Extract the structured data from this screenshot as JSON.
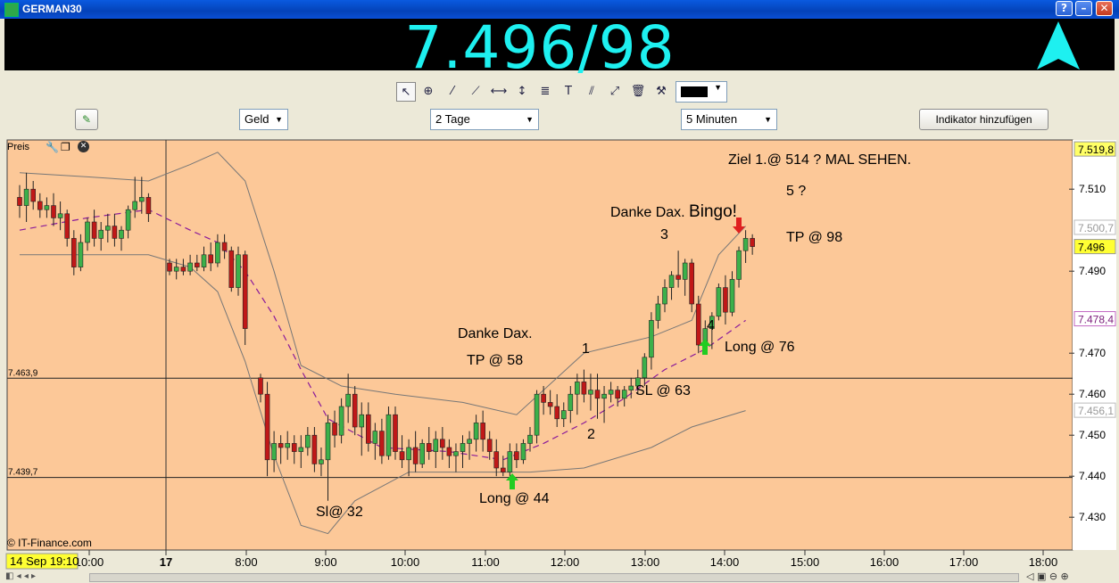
{
  "window": {
    "title": "GERMAN30"
  },
  "quote": {
    "value": "7.496/98",
    "direction": "up",
    "color": "#1ef0f0"
  },
  "toolbar": {
    "tools": [
      "pointer-icon",
      "zoom-icon",
      "line-icon",
      "extended-line-icon",
      "horizontal-line-icon",
      "vertical-line-icon",
      "fibonacci-icon",
      "text-icon",
      "parallel-lines-icon",
      "trend-channel-icon",
      "trash-icon",
      "tools-icon"
    ],
    "color_swatch": "#000000"
  },
  "controls": {
    "price_type": "Geld",
    "period": "2 Tage",
    "interval": "5 Minuten",
    "add_indicator": "Indikator hinzufügen"
  },
  "chart": {
    "panel_label": "Preis",
    "copyright": "© IT-Finance.com",
    "background": "#fcc898",
    "yticks": [
      "7.510",
      "7.490",
      "7.480",
      "7.470",
      "7.460",
      "7.450",
      "7.440",
      "7.430"
    ],
    "xticks": [
      "10:00",
      "17",
      "8:00",
      "9:00",
      "10:00",
      "11:00",
      "12:00",
      "13:00",
      "14:00",
      "15:00",
      "16:00",
      "17:00",
      "18:00"
    ],
    "date_badge": "14 Sep 19:10",
    "price_badges": {
      "high": "7.519,8",
      "upper_band": "7.500,7",
      "last": "7.496",
      "ma": "7.478,4",
      "lower_band": "7.456,1"
    },
    "hlines": [
      {
        "label": "7.463,9"
      },
      {
        "label": "7.439,7"
      }
    ],
    "annotations": {
      "ziel": "Ziel 1.@ 514 ? MAL SEHEN.",
      "five": "5 ?",
      "danke_bingo_a": "Danke Dax.",
      "danke_bingo_b": "Bingo!",
      "tp98": "TP @ 98",
      "three": "3",
      "four": "4",
      "long76": "Long @ 76",
      "danke": "Danke Dax.",
      "tp58": "TP @ 58",
      "one": "1",
      "sl63": "SL @ 63",
      "two": "2",
      "sl32": "Sl@ 32",
      "long44": "Long @ 44"
    }
  },
  "chart_data": {
    "type": "candlestick",
    "title": "GERMAN30",
    "ylim": [
      7422,
      7522
    ],
    "indicators": [
      "bollinger-bands",
      "moving-average"
    ],
    "candles": [
      [
        7508,
        7511,
        7503,
        7506
      ],
      [
        7506,
        7514,
        7502,
        7510
      ],
      [
        7510,
        7512,
        7505,
        7507
      ],
      [
        7507,
        7509,
        7503,
        7505
      ],
      [
        7505,
        7508,
        7503,
        7506
      ],
      [
        7506,
        7509,
        7501,
        7503
      ],
      [
        7503,
        7507,
        7500,
        7504
      ],
      [
        7504,
        7505,
        7496,
        7498
      ],
      [
        7498,
        7500,
        7489,
        7491
      ],
      [
        7491,
        7499,
        7490,
        7497
      ],
      [
        7497,
        7503,
        7495,
        7502
      ],
      [
        7502,
        7505,
        7496,
        7498
      ],
      [
        7498,
        7502,
        7495,
        7500
      ],
      [
        7500,
        7504,
        7497,
        7501
      ],
      [
        7501,
        7504,
        7496,
        7498
      ],
      [
        7498,
        7501,
        7495,
        7500
      ],
      [
        7500,
        7506,
        7498,
        7505
      ],
      [
        7505,
        7513,
        7503,
        7507
      ],
      [
        7507,
        7513,
        7504,
        7508
      ],
      [
        7508,
        7509,
        7502,
        7504
      ],
      [
        7492,
        7493,
        7489,
        7490
      ],
      [
        7490,
        7493,
        7488,
        7491
      ],
      [
        7491,
        7493,
        7489,
        7490
      ],
      [
        7490,
        7494,
        7489,
        7492
      ],
      [
        7492,
        7494,
        7490,
        7491
      ],
      [
        7491,
        7496,
        7490,
        7494
      ],
      [
        7494,
        7497,
        7490,
        7492
      ],
      [
        7492,
        7499,
        7491,
        7497
      ],
      [
        7497,
        7499,
        7493,
        7495
      ],
      [
        7495,
        7496,
        7485,
        7486
      ],
      [
        7486,
        7496,
        7484,
        7494
      ],
      [
        7494,
        7495,
        7472,
        7476
      ],
      [
        7464,
        7465,
        7458,
        7460
      ],
      [
        7460,
        7463,
        7440,
        7444
      ],
      [
        7444,
        7451,
        7441,
        7448
      ],
      [
        7448,
        7450,
        7443,
        7447
      ],
      [
        7447,
        7451,
        7444,
        7448
      ],
      [
        7448,
        7450,
        7443,
        7446
      ],
      [
        7446,
        7450,
        7442,
        7447
      ],
      [
        7447,
        7452,
        7445,
        7450
      ],
      [
        7450,
        7452,
        7441,
        7443
      ],
      [
        7443,
        7447,
        7440,
        7444
      ],
      [
        7444,
        7455,
        7434,
        7453
      ],
      [
        7453,
        7456,
        7447,
        7450
      ],
      [
        7450,
        7459,
        7448,
        7457
      ],
      [
        7457,
        7465,
        7453,
        7460
      ],
      [
        7460,
        7462,
        7450,
        7452
      ],
      [
        7452,
        7458,
        7445,
        7455
      ],
      [
        7455,
        7458,
        7446,
        7448
      ],
      [
        7448,
        7453,
        7444,
        7451
      ],
      [
        7451,
        7454,
        7443,
        7445
      ],
      [
        7445,
        7457,
        7444,
        7455
      ],
      [
        7455,
        7457,
        7444,
        7446
      ],
      [
        7446,
        7450,
        7442,
        7444
      ],
      [
        7444,
        7449,
        7440,
        7447
      ],
      [
        7447,
        7451,
        7441,
        7443
      ],
      [
        7443,
        7449,
        7442,
        7448
      ],
      [
        7448,
        7452,
        7444,
        7446
      ],
      [
        7446,
        7451,
        7442,
        7449
      ],
      [
        7449,
        7452,
        7444,
        7447
      ],
      [
        7447,
        7449,
        7442,
        7445
      ],
      [
        7445,
        7448,
        7441,
        7446
      ],
      [
        7446,
        7450,
        7442,
        7448
      ],
      [
        7448,
        7451,
        7444,
        7449
      ],
      [
        7449,
        7455,
        7446,
        7453
      ],
      [
        7453,
        7456,
        7446,
        7449
      ],
      [
        7449,
        7451,
        7444,
        7446
      ],
      [
        7446,
        7449,
        7440,
        7442
      ],
      [
        7442,
        7445,
        7440,
        7441
      ],
      [
        7441,
        7448,
        7440,
        7446
      ],
      [
        7446,
        7448,
        7442,
        7444
      ],
      [
        7444,
        7449,
        7443,
        7448
      ],
      [
        7448,
        7452,
        7446,
        7450
      ],
      [
        7450,
        7461,
        7448,
        7460
      ],
      [
        7460,
        7462,
        7455,
        7458
      ],
      [
        7458,
        7461,
        7455,
        7457
      ],
      [
        7457,
        7460,
        7452,
        7454
      ],
      [
        7454,
        7458,
        7452,
        7456
      ],
      [
        7456,
        7462,
        7453,
        7460
      ],
      [
        7460,
        7465,
        7455,
        7463
      ],
      [
        7463,
        7466,
        7458,
        7460
      ],
      [
        7460,
        7465,
        7456,
        7461
      ],
      [
        7461,
        7465,
        7454,
        7459
      ],
      [
        7459,
        7462,
        7453,
        7460
      ],
      [
        7460,
        7463,
        7458,
        7461
      ],
      [
        7461,
        7462,
        7457,
        7459
      ],
      [
        7459,
        7462,
        7457,
        7461
      ],
      [
        7461,
        7464,
        7459,
        7462
      ],
      [
        7462,
        7466,
        7460,
        7464
      ],
      [
        7464,
        7470,
        7462,
        7469
      ],
      [
        7469,
        7480,
        7466,
        7478
      ],
      [
        7478,
        7484,
        7476,
        7482
      ],
      [
        7482,
        7488,
        7480,
        7486
      ],
      [
        7486,
        7490,
        7483,
        7489
      ],
      [
        7489,
        7495,
        7486,
        7488
      ],
      [
        7488,
        7493,
        7484,
        7492
      ],
      [
        7492,
        7493,
        7480,
        7482
      ],
      [
        7482,
        7484,
        7470,
        7472
      ],
      [
        7472,
        7478,
        7470,
        7476
      ],
      [
        7476,
        7480,
        7471,
        7479
      ],
      [
        7479,
        7487,
        7478,
        7486
      ],
      [
        7486,
        7489,
        7477,
        7480
      ],
      [
        7480,
        7490,
        7479,
        7488
      ],
      [
        7488,
        7496,
        7486,
        7495
      ],
      [
        7495,
        7500,
        7492,
        7498
      ],
      [
        7498,
        7499,
        7494,
        7496
      ]
    ]
  }
}
